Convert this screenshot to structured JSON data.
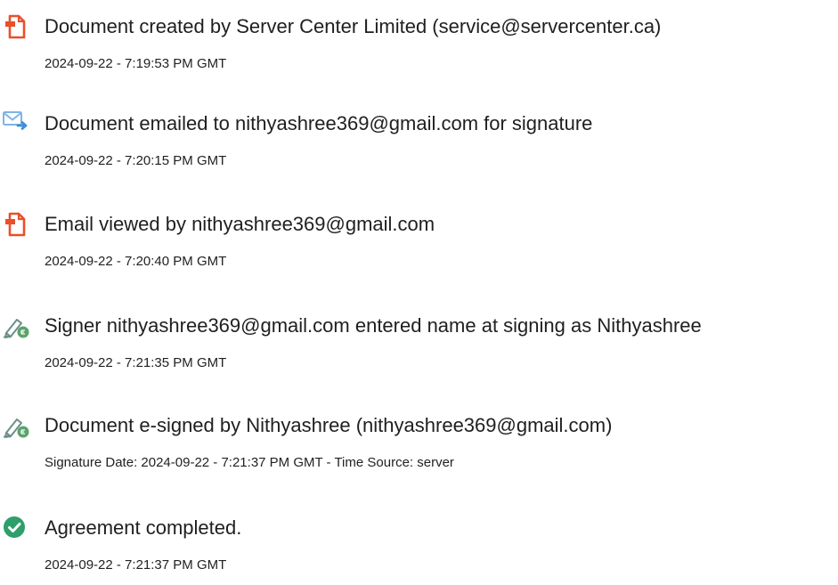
{
  "colors": {
    "doc_icon": "#e8502a",
    "email_icon": "#3b8fd9",
    "sign_icon": "#5aa36b",
    "check_icon": "#2e9e6a",
    "text": "#1f1f1f"
  },
  "events": [
    {
      "icon": "document-icon",
      "title": "Document created by Server Center Limited (service@servercenter.ca)",
      "detail": "2024-09-22 - 7:19:53 PM GMT"
    },
    {
      "icon": "email-icon",
      "title": "Document emailed to nithyashree369@gmail.com for signature",
      "detail": "2024-09-22 - 7:20:15 PM GMT"
    },
    {
      "icon": "document-icon",
      "title": "Email viewed by nithyashree369@gmail.com",
      "detail": "2024-09-22 - 7:20:40 PM GMT"
    },
    {
      "icon": "signature-icon",
      "title": "Signer nithyashree369@gmail.com entered name at signing as Nithyashree",
      "detail": "2024-09-22 - 7:21:35 PM GMT"
    },
    {
      "icon": "signature-icon",
      "title": "Document e-signed by Nithyashree (nithyashree369@gmail.com)",
      "detail": "Signature Date: 2024-09-22 - 7:21:37 PM GMT - Time Source: server"
    },
    {
      "icon": "checkmark-icon",
      "title": "Agreement completed.",
      "detail": "2024-09-22 - 7:21:37 PM GMT"
    }
  ]
}
